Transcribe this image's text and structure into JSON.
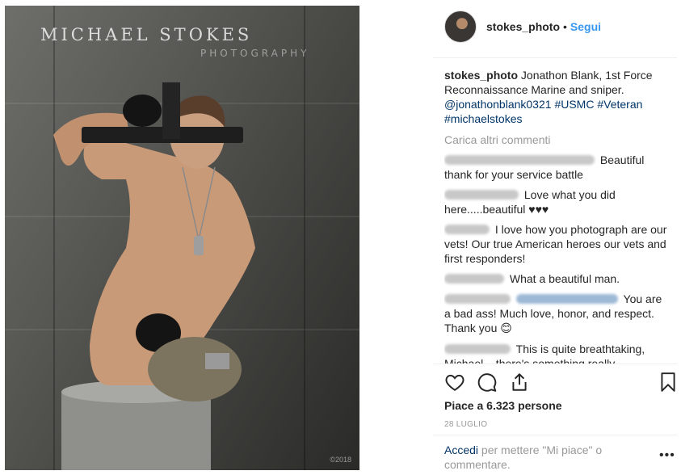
{
  "photo": {
    "watermark_name": "MICHAEL STOKES",
    "watermark_sub": "PHOTOGRAPHY",
    "watermark_year": "©2018"
  },
  "header": {
    "username": "stokes_photo",
    "separator": "•",
    "follow_label": "Segui"
  },
  "caption": {
    "username": "stokes_photo",
    "text": "Jonathon Blank, 1st Force Reconnaissance Marine and sniper.",
    "mention": "@jonathonblank0321",
    "hashtags": [
      "#USMC",
      "#Veteran",
      "#michaelstokes"
    ]
  },
  "load_more_label": "Carica altri commenti",
  "comments": [
    {
      "text": "Beautiful thank for your service battle"
    },
    {
      "text": "Love what you did here.....beautiful ♥♥♥"
    },
    {
      "text": "I love how you photograph are our vets! Our true American heroes our vets and first responders!"
    },
    {
      "text": "What a beautiful man."
    },
    {
      "text": "You are a bad ass! Much love, honor, and respect. Thank you",
      "emoji": "😊"
    },
    {
      "text": "This is quite breathtaking, Michael... there's something really"
    }
  ],
  "actions": {
    "like_icon": "heart-icon",
    "comment_icon": "comment-icon",
    "share_icon": "share-icon",
    "save_icon": "bookmark-icon"
  },
  "likes": "Piace a 6.323 persone",
  "date": "28 LUGLIO",
  "footer": {
    "login_link": "Accedi",
    "login_text": "per mettere \"Mi piace\" o commentare.",
    "more_icon": "more-options-icon"
  }
}
